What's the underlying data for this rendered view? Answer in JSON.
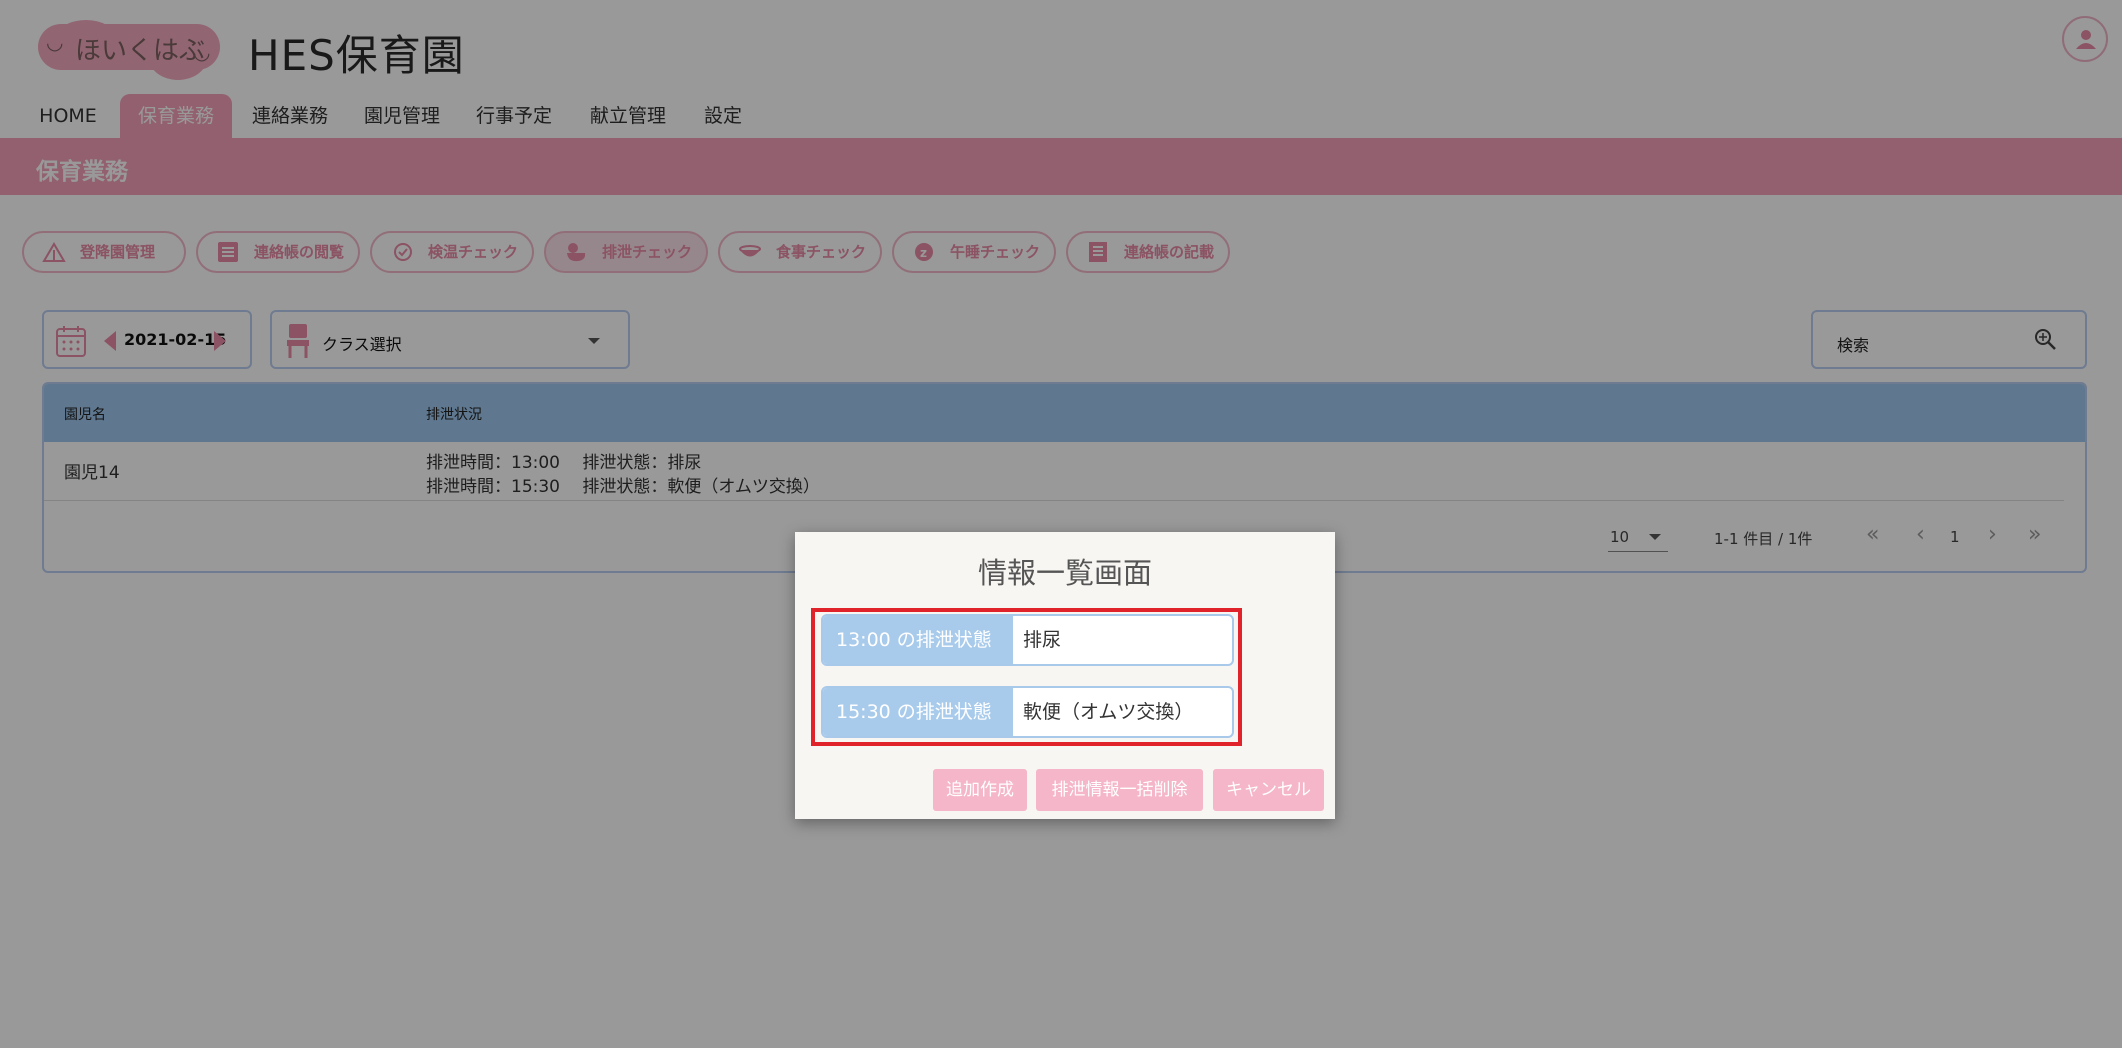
{
  "header": {
    "logo_text": "ほいくはぶ",
    "title": "HES保育園"
  },
  "nav": {
    "items": [
      {
        "label": "HOME"
      },
      {
        "label": "保育業務",
        "active": true
      },
      {
        "label": "連絡業務"
      },
      {
        "label": "園児管理"
      },
      {
        "label": "行事予定"
      },
      {
        "label": "献立管理"
      },
      {
        "label": "設定"
      }
    ]
  },
  "page": {
    "title": "保育業務"
  },
  "chips": [
    {
      "label": "登降園管理",
      "icon": "gate-icon"
    },
    {
      "label": "連絡帳の閲覧",
      "icon": "list-icon"
    },
    {
      "label": "検温チェック",
      "icon": "thermometer-icon"
    },
    {
      "label": "排泄チェック",
      "icon": "duck-icon",
      "active": true
    },
    {
      "label": "食事チェック",
      "icon": "bowl-icon"
    },
    {
      "label": "午睡チェック",
      "icon": "sleep-icon"
    },
    {
      "label": "連絡帳の記載",
      "icon": "notebook-icon"
    }
  ],
  "toolbar": {
    "date": "2021-02-15",
    "class_select": "クラス選択",
    "search_label": "検索"
  },
  "table": {
    "headers": [
      "園児名",
      "排泄状況"
    ],
    "rows": [
      {
        "name": "園児14",
        "status_lines": [
          "排泄時間：13:00　 排泄状態：排尿",
          "排泄時間：15:30　 排泄状態：軟便（オムツ交換）"
        ]
      }
    ],
    "pager": {
      "page_size": "10",
      "range": "1-1 件目 / 1件",
      "current_page": "1",
      "first": "«",
      "prev": "‹",
      "next": "›",
      "last": "»"
    }
  },
  "dialog": {
    "title": "情報一覧画面",
    "fields": [
      {
        "label": "13:00 の排泄状態",
        "value": "排尿"
      },
      {
        "label": "15:30 の排泄状態",
        "value": "軟便（オムツ交換）"
      }
    ],
    "buttons": {
      "add": "追加作成",
      "delete_all": "排泄情報一括削除",
      "cancel": "キャンセル"
    }
  },
  "colors": {
    "accent_pink": "#f3a0b8",
    "header_blue": "#9ec8ee",
    "highlight_red": "#e0232b"
  }
}
